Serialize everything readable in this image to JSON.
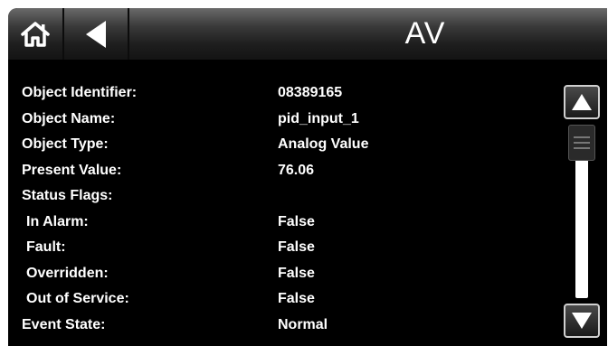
{
  "header": {
    "title": "AV",
    "home_icon": "home-icon",
    "back_icon": "back-arrow-icon"
  },
  "properties": [
    {
      "label": "Object Identifier:",
      "value": "08389165",
      "indent": false
    },
    {
      "label": "Object Name:",
      "value": "pid_input_1",
      "indent": false
    },
    {
      "label": "Object Type:",
      "value": "Analog Value",
      "indent": false
    },
    {
      "label": "Present Value:",
      "value": "76.06",
      "indent": false
    },
    {
      "label": "Status Flags:",
      "value": "",
      "indent": false
    },
    {
      "label": "In Alarm:",
      "value": "False",
      "indent": true
    },
    {
      "label": "Fault:",
      "value": "False",
      "indent": true
    },
    {
      "label": "Overridden:",
      "value": "False",
      "indent": true
    },
    {
      "label": "Out of Service:",
      "value": "False",
      "indent": true
    },
    {
      "label": "Event State:",
      "value": "Normal",
      "indent": false
    }
  ],
  "scrollbar": {
    "up_icon": "scroll-up-arrow-icon",
    "down_icon": "scroll-down-arrow-icon",
    "position_fraction": 0.0
  },
  "colors": {
    "background": "#000000",
    "text": "#ffffff",
    "header_top": "#6a6a6a",
    "header_bottom": "#141414"
  }
}
